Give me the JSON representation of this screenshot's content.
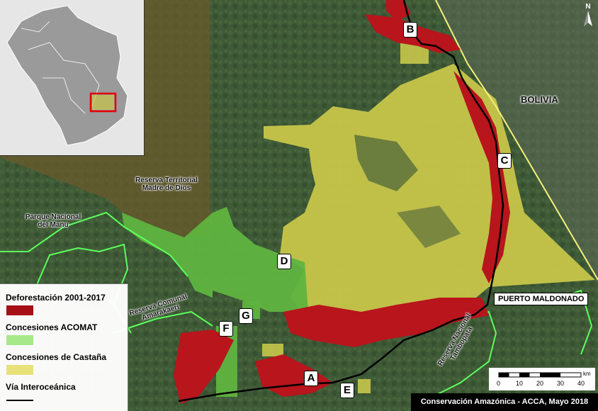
{
  "map": {
    "labels": {
      "A": "A",
      "B": "B",
      "C": "C",
      "D": "D",
      "E": "E",
      "F": "F",
      "G": "G"
    },
    "places": {
      "reserva_territorial": [
        "Reserva Territorial",
        "Madre de Dios"
      ],
      "parque_manu": [
        "Parque Nacional",
        "del Manu"
      ],
      "reserva_comunal": [
        "Reserva Comunal",
        "Amarakaeri"
      ],
      "reserva_tambopata": [
        "Reserva Nacional",
        "Tambopata"
      ],
      "country": "BOLIVIA",
      "city": "PUERTO MALDONADO"
    },
    "north_arrow": "N"
  },
  "legend": {
    "items": [
      {
        "label": "Deforestación 2001-2017",
        "color": "#a50f15"
      },
      {
        "label": "Concesiones ACOMAT",
        "color": "#a6e88a"
      },
      {
        "label": "Concesiones de Castaña",
        "color": "#e8e27a"
      },
      {
        "label": "Vía Interoceánica",
        "color": "#000000"
      }
    ]
  },
  "scale": {
    "ticks": [
      "0",
      "10",
      "20",
      "30",
      "40"
    ],
    "unit": "km"
  },
  "credit": "Conservación Amazónica - ACCA, Mayo 2018",
  "colors": {
    "forest": "#3f5a37",
    "castana": "#c7c64a",
    "acomat": "#5fb43f",
    "reserve_overlay": "#6b5a2c",
    "deforestation": "#b8151c",
    "boundary": "#5cff5c",
    "inset_highlight": "#e20000"
  }
}
